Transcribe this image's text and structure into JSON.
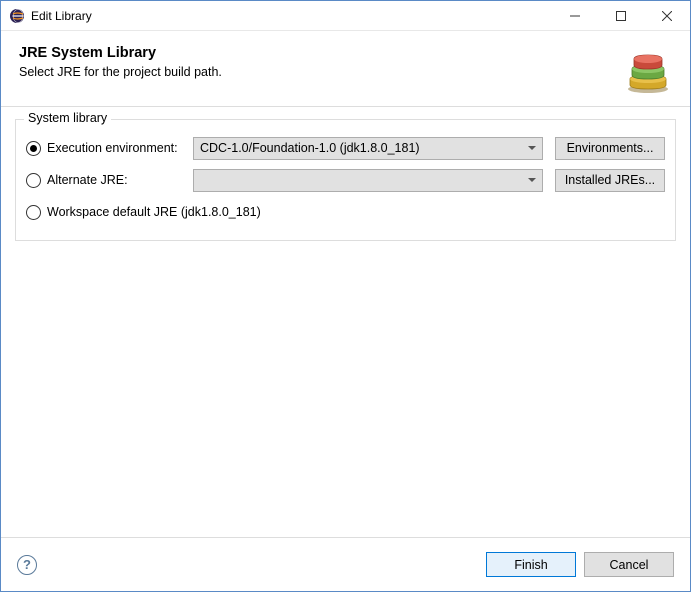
{
  "titlebar": {
    "title": "Edit Library"
  },
  "header": {
    "title": "JRE System Library",
    "description": "Select JRE for the project build path."
  },
  "group": {
    "label": "System library",
    "options": {
      "exec_env": {
        "label": "Execution environment:",
        "value": "CDC-1.0/Foundation-1.0 (jdk1.8.0_181)",
        "button": "Environments..."
      },
      "alt_jre": {
        "label": "Alternate JRE:",
        "value": "",
        "button": "Installed JREs..."
      },
      "workspace": {
        "label": "Workspace default JRE (jdk1.8.0_181)"
      }
    },
    "selected": "exec_env"
  },
  "footer": {
    "finish": "Finish",
    "cancel": "Cancel"
  }
}
